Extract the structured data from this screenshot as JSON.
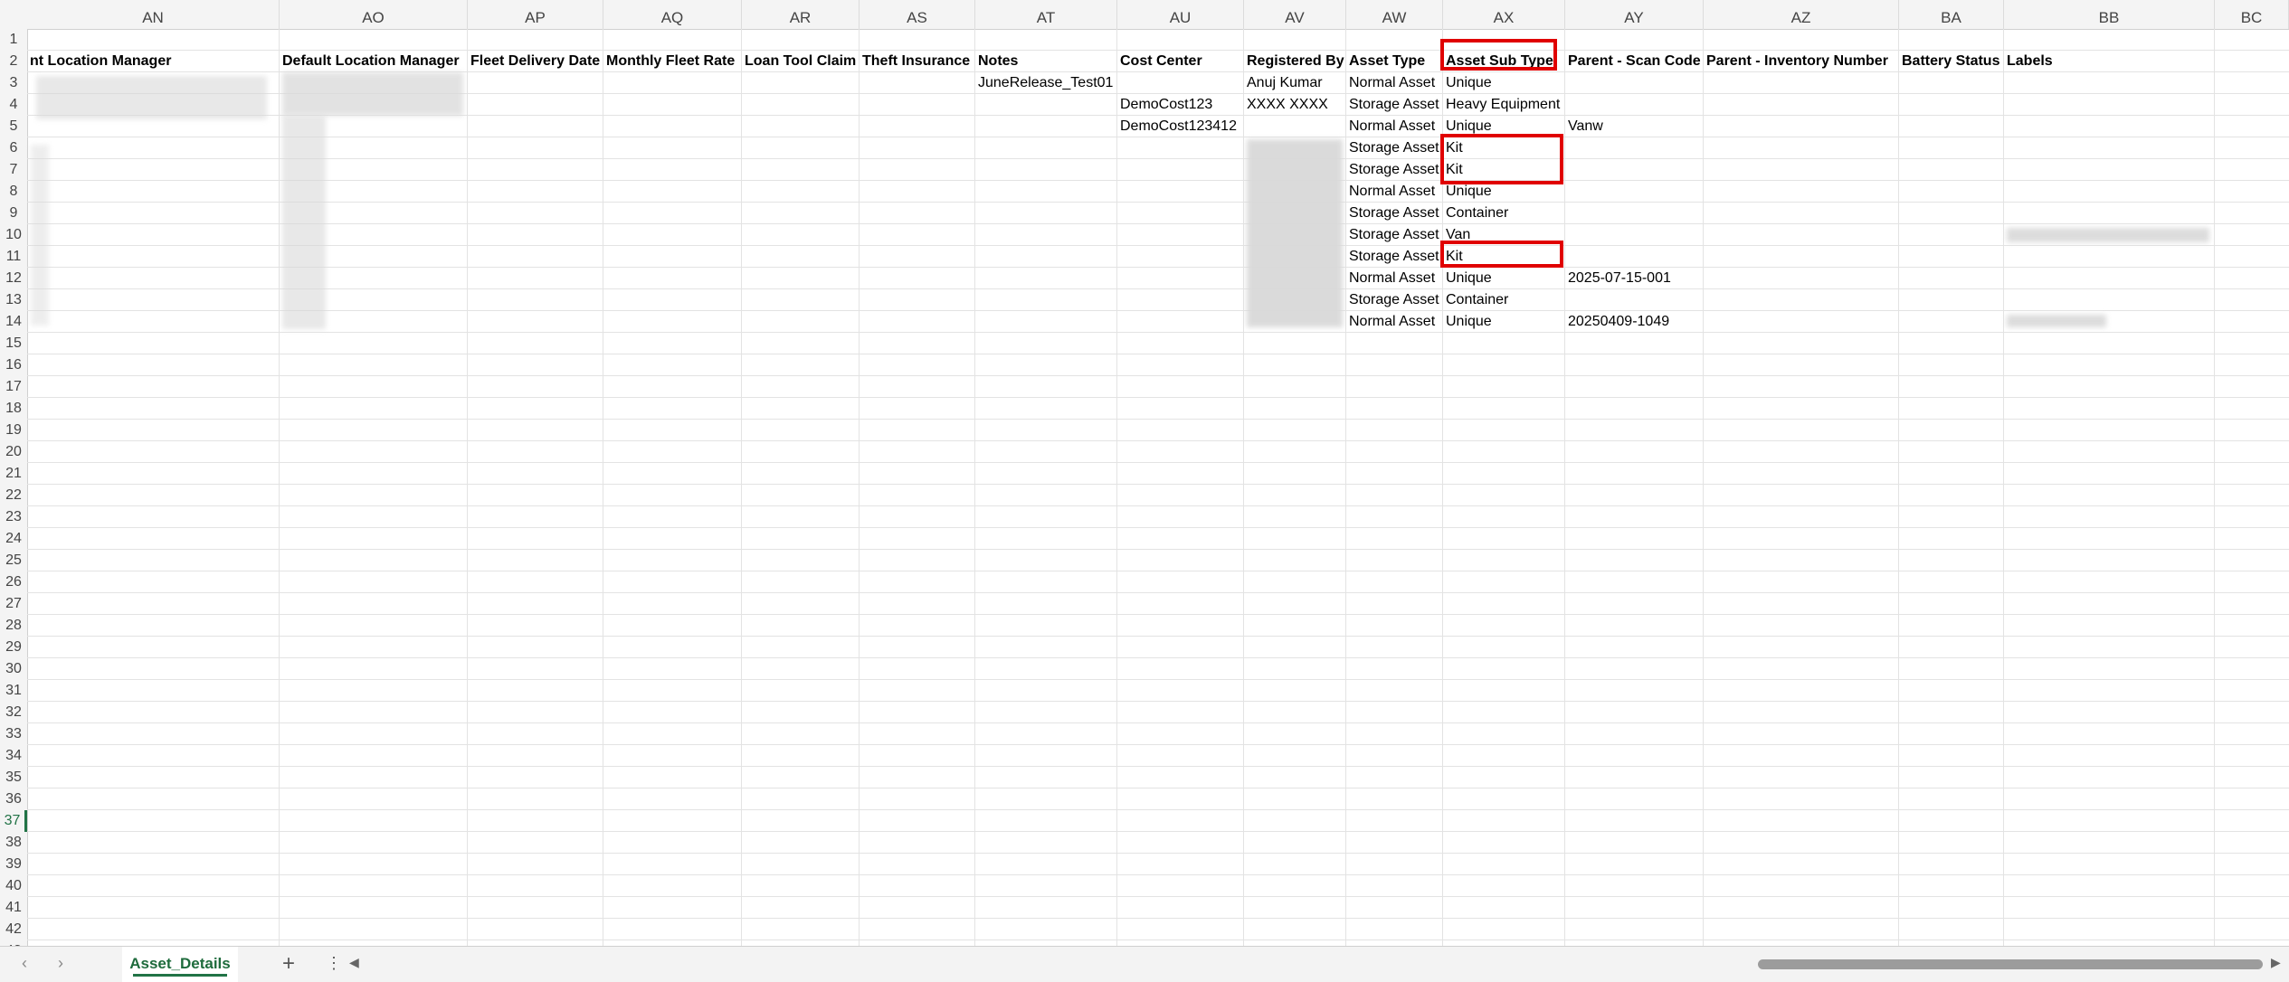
{
  "columns": [
    "AN",
    "AO",
    "AP",
    "AQ",
    "AR",
    "AS",
    "AT",
    "AU",
    "AV",
    "AW",
    "AX",
    "AY",
    "AZ",
    "BA",
    "BB",
    "BC"
  ],
  "row_numbers": [
    "1",
    "2",
    "3",
    "4",
    "5",
    "6",
    "7",
    "8",
    "9",
    "10",
    "11",
    "12",
    "13",
    "14",
    "15",
    "16",
    "17",
    "18",
    "19",
    "20",
    "21",
    "22",
    "23",
    "24",
    "25",
    "26",
    "27",
    "28",
    "29",
    "30",
    "31",
    "32",
    "33",
    "34",
    "35",
    "36",
    "37",
    "38",
    "39",
    "40",
    "41",
    "42",
    "43"
  ],
  "active_row": "37",
  "headers": {
    "an": "nt Location Manager",
    "ao": "Default Location Manager",
    "ap": "Fleet Delivery Date",
    "aq": "Monthly Fleet Rate",
    "ar": "Loan Tool Claim",
    "as": "Theft Insurance",
    "at": "Notes",
    "au": "Cost Center",
    "av": "Registered By",
    "aw": "Asset Type",
    "ax": "Asset Sub Type",
    "ay": "Parent - Scan Code",
    "az": "Parent - Inventory Number",
    "ba": "Battery Status",
    "bb": "Labels"
  },
  "rows": {
    "r3": {
      "at": "JuneRelease_Test01",
      "av": "Anuj Kumar",
      "aw": "Normal Asset",
      "ax": "Unique"
    },
    "r4": {
      "au": "DemoCost123",
      "av": "XXXX XXXX",
      "aw": "Storage Asset",
      "ax": "Heavy Equipment"
    },
    "r5": {
      "au": "DemoCost123412",
      "aw": "Normal Asset",
      "ax": "Unique",
      "ay": "Vanw"
    },
    "r6": {
      "aw": "Storage Asset",
      "ax": "Kit"
    },
    "r7": {
      "aw": "Storage Asset",
      "ax": "Kit"
    },
    "r8": {
      "aw": "Normal Asset",
      "ax": "Unique"
    },
    "r9": {
      "aw": "Storage Asset",
      "ax": "Container"
    },
    "r10": {
      "aw": "Storage Asset",
      "ax": "Van"
    },
    "r11": {
      "aw": "Storage Asset",
      "ax": "Kit"
    },
    "r12": {
      "aw": "Normal Asset",
      "ax": "Unique",
      "ay": "2025-07-15-001"
    },
    "r13": {
      "aw": "Storage Asset",
      "ax": "Container"
    },
    "r14": {
      "aw": "Normal Asset",
      "ax": "Unique",
      "ay": "20250409-1049"
    }
  },
  "sheet_tab": "Asset_Details",
  "colors": {
    "highlight": "#e00000",
    "accent": "#217346"
  }
}
